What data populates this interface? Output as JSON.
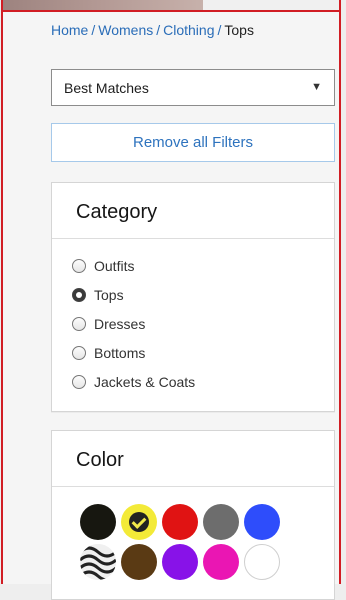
{
  "breadcrumb": {
    "items": [
      {
        "label": "Home"
      },
      {
        "label": "Womens"
      },
      {
        "label": "Clothing"
      }
    ],
    "current": "Tops",
    "separator": "/"
  },
  "sort": {
    "selected": "Best Matches",
    "arrow_icon": "triangle-down"
  },
  "filters": {
    "clear_label": "Remove all Filters"
  },
  "category": {
    "title": "Category",
    "options": [
      {
        "label": "Outfits",
        "selected": false
      },
      {
        "label": "Tops",
        "selected": true
      },
      {
        "label": "Dresses",
        "selected": false
      },
      {
        "label": "Bottoms",
        "selected": false
      },
      {
        "label": "Jackets & Coats",
        "selected": false
      }
    ]
  },
  "color": {
    "title": "Color",
    "swatches": [
      {
        "name": "black",
        "hex": "#171710",
        "selected": false
      },
      {
        "name": "yellow",
        "hex": "#f3ea38",
        "selected": true
      },
      {
        "name": "red",
        "hex": "#e01313",
        "selected": false
      },
      {
        "name": "grey",
        "hex": "#6d6d6d",
        "selected": false
      },
      {
        "name": "blue",
        "hex": "#2e4dfb",
        "selected": false
      },
      {
        "name": "pattern",
        "hex": "#e9e9e9",
        "selected": false
      },
      {
        "name": "brown",
        "hex": "#5a3a14",
        "selected": false
      },
      {
        "name": "purple",
        "hex": "#8812e8",
        "selected": false
      },
      {
        "name": "pink",
        "hex": "#ea16b3",
        "selected": false
      },
      {
        "name": "white",
        "hex": "#ffffff",
        "selected": false
      }
    ]
  }
}
